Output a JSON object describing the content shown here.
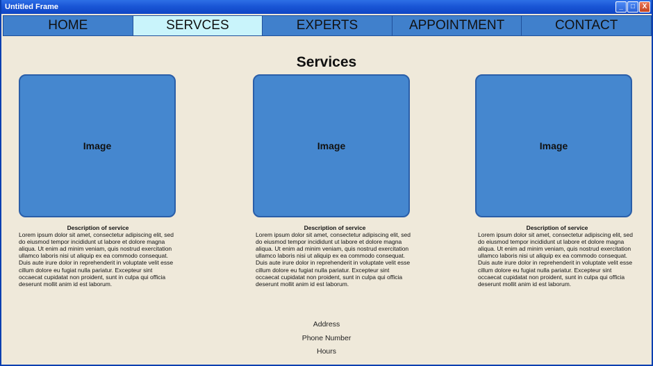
{
  "window": {
    "title": "Untitled Frame",
    "min": "_",
    "max": "□",
    "close": "X"
  },
  "nav": {
    "items": [
      {
        "label": "HOME"
      },
      {
        "label": "SERVCES"
      },
      {
        "label": "EXPERTS"
      },
      {
        "label": "APPOINTMENT"
      },
      {
        "label": "CONTACT"
      }
    ],
    "active_index": 1
  },
  "page": {
    "title": "Services"
  },
  "services": [
    {
      "image_label": "Image",
      "desc_title": "Description of service",
      "desc_text": "Lorem ipsum dolor sit amet, consectetur adipiscing elit, sed do eiusmod tempor incididunt ut labore et dolore magna aliqua. Ut enim ad minim veniam, quis nostrud exercitation ullamco laboris nisi ut aliquip ex ea commodo consequat. Duis aute irure dolor in reprehenderit in voluptate velit esse cillum dolore eu fugiat nulla pariatur. Excepteur sint occaecat cupidatat non proident, sunt in culpa qui officia deserunt mollit anim id est laborum."
    },
    {
      "image_label": "Image",
      "desc_title": "Description of service",
      "desc_text": "Lorem ipsum dolor sit amet, consectetur adipiscing elit, sed do eiusmod tempor incididunt ut labore et dolore magna aliqua. Ut enim ad minim veniam, quis nostrud exercitation ullamco laboris nisi ut aliquip ex ea commodo consequat. Duis aute irure dolor in reprehenderit in voluptate velit esse cillum dolore eu fugiat nulla pariatur. Excepteur sint occaecat cupidatat non proident, sunt in culpa qui officia deserunt mollit anim id est laborum."
    },
    {
      "image_label": "Image",
      "desc_title": "Description of service",
      "desc_text": "Lorem ipsum dolor sit amet, consectetur adipiscing elit, sed do eiusmod tempor incididunt ut labore et dolore magna aliqua. Ut enim ad minim veniam, quis nostrud exercitation ullamco laboris nisi ut aliquip ex ea commodo consequat. Duis aute irure dolor in reprehenderit in voluptate velit esse cillum dolore eu fugiat nulla pariatur. Excepteur sint occaecat cupidatat non proident, sunt in culpa qui officia deserunt mollit anim id est laborum."
    }
  ],
  "footer": {
    "address": "Address",
    "phone": "Phone Number",
    "hours": "Hours"
  },
  "colors": {
    "nav_bg": "#4080cc",
    "nav_active": "#c9f4fb",
    "page_bg": "#efe9da",
    "image_fill": "#4587cf"
  }
}
